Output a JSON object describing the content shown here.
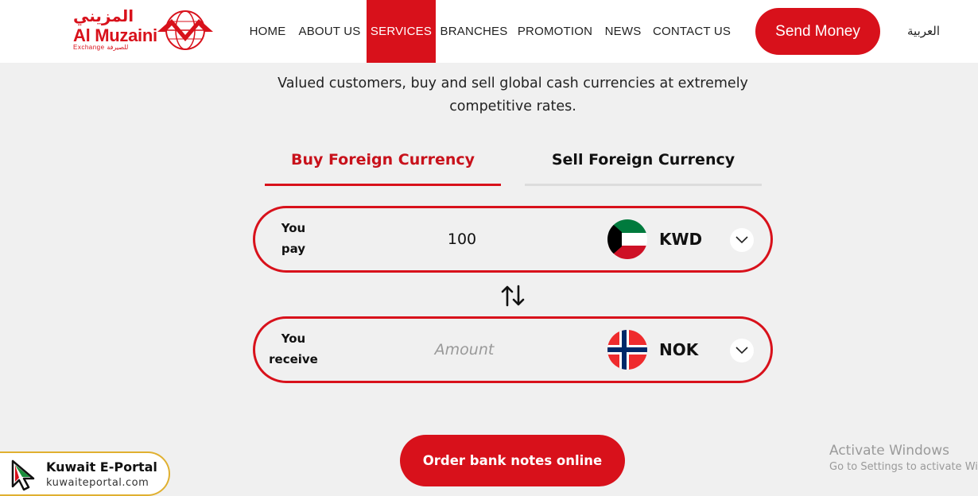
{
  "brand": {
    "name_ar": "المزيني",
    "name_en": "Al Muzaini",
    "sub_en": "Exchange",
    "sub_ar": "للصيرفة",
    "primary_color": "#d8111b"
  },
  "nav": {
    "items": [
      {
        "label": "HOME"
      },
      {
        "label": "ABOUT US"
      },
      {
        "label": "SERVICES",
        "active": true
      },
      {
        "label": "BRANCHES"
      },
      {
        "label": "PROMOTION"
      },
      {
        "label": "NEWS"
      },
      {
        "label": "CONTACT US"
      }
    ],
    "cta": "Send Money",
    "language": "العربية"
  },
  "intro": "Valued customers, buy and sell global cash currencies at extremely competitive rates.",
  "tabs": [
    {
      "label": "Buy Foreign Currency",
      "active": true
    },
    {
      "label": "Sell Foreign Currency",
      "active": false
    }
  ],
  "converter": {
    "pay": {
      "label_line1": "You",
      "label_line2": "pay",
      "value": "100",
      "currency": "KWD",
      "flag": "kuwait-flag-icon"
    },
    "receive": {
      "label_line1": "You",
      "label_line2": "receive",
      "value": "",
      "placeholder": "Amount",
      "currency": "NOK",
      "flag": "norway-flag-icon"
    },
    "swap_icon": "swap-arrows-icon"
  },
  "order_button": "Order bank notes online",
  "overlays": {
    "portal_name": "Kuwait E-Portal",
    "portal_url": "kuwaiteportal.com",
    "windows_title": "Activate Windows",
    "windows_sub": "Go to Settings to activate Windows."
  }
}
